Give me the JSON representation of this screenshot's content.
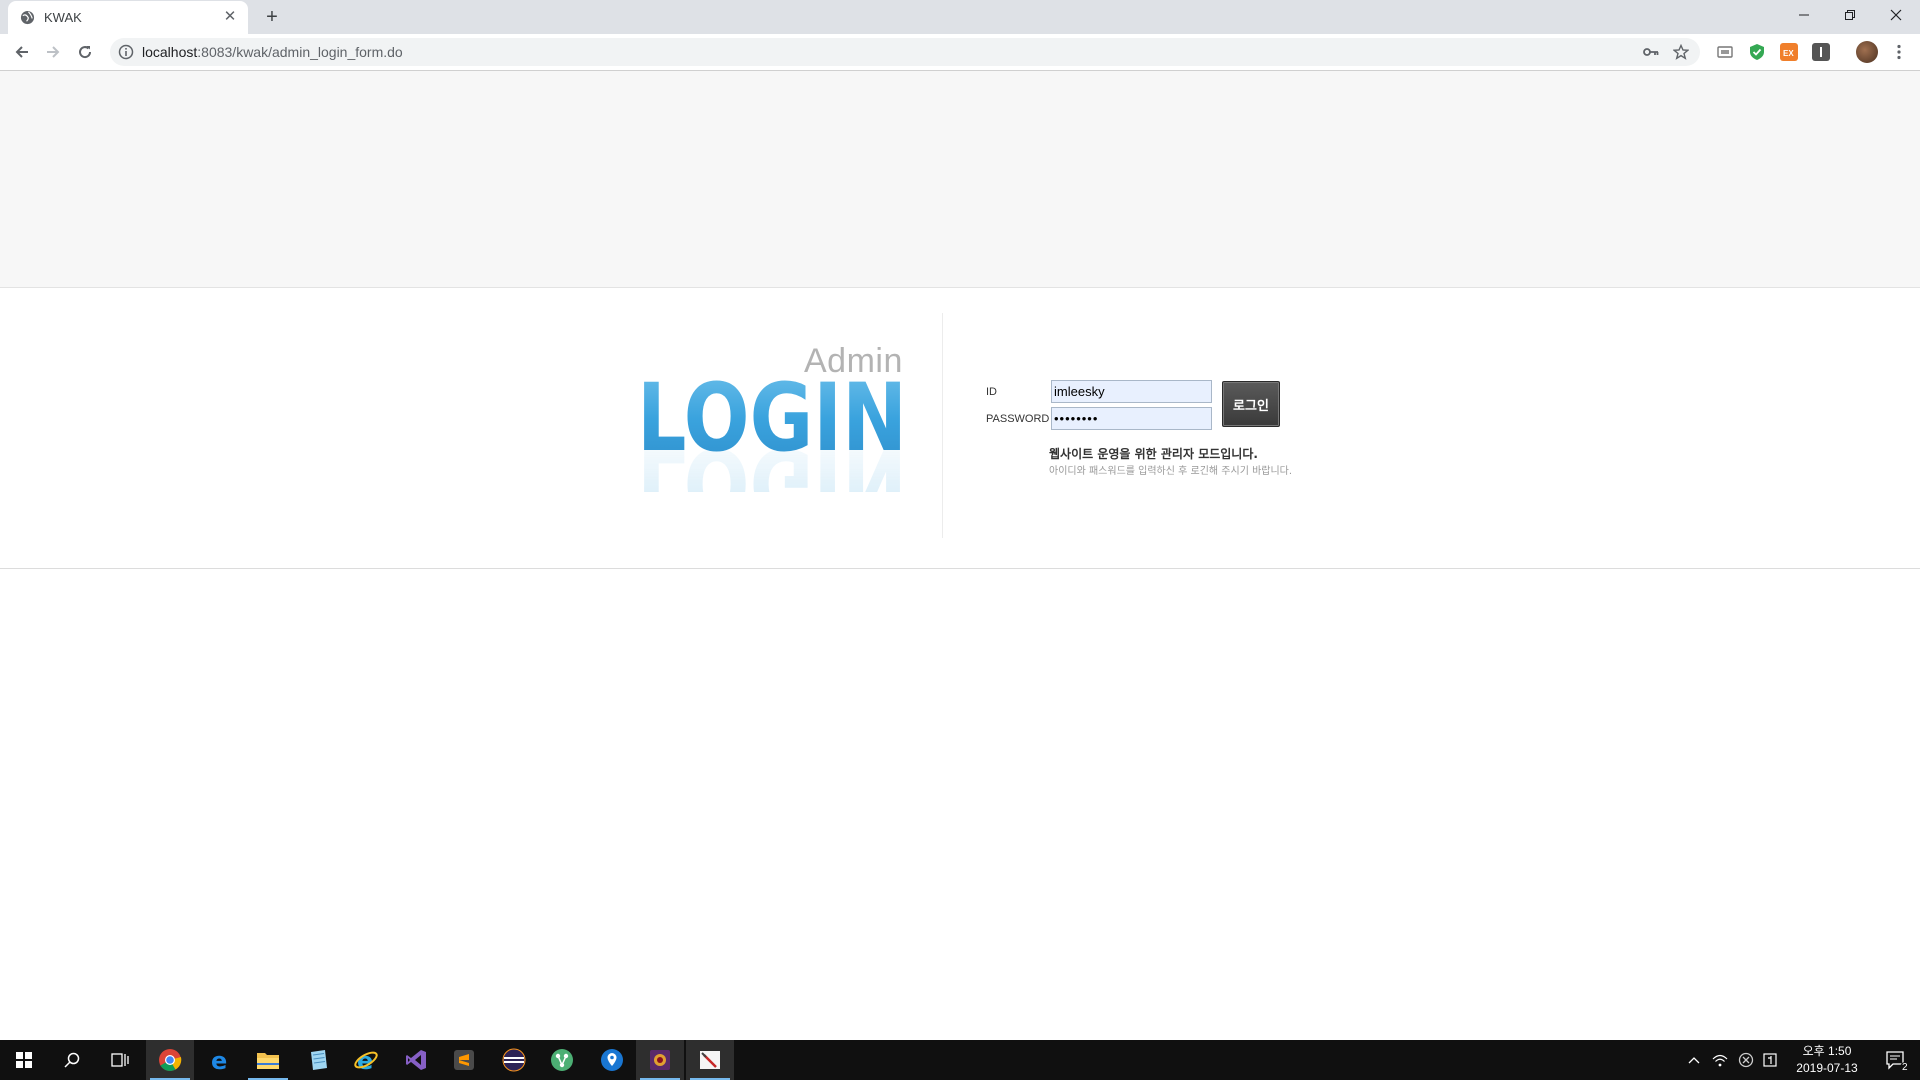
{
  "browser": {
    "tab_title": "KWAK",
    "new_tab_label": "+",
    "url_host": "localhost",
    "url_rest": ":8083/kwak/admin_login_form.do"
  },
  "login": {
    "admin_text": "Admin",
    "logo_text": "LOGIN",
    "id_label": "ID",
    "password_label": "PASSWORD",
    "id_value": "imleesky",
    "password_value": "••••••••",
    "button_label": "로그인",
    "notice_main": "웹사이트 운영을 위한 관리자 모드입니다.",
    "notice_sub": "아이디와 패스워드를 입력하신 후 로긴해 주시기 바랍니다."
  },
  "colors": {
    "logo_blue": "#3aa3de",
    "logo_light": "#8fd0f2",
    "field_bg": "#e8f0fe",
    "button_bg": "#444444"
  },
  "taskbar": {
    "clock_period_time": "오후 1:50",
    "clock_date": "2019-07-13",
    "notification_count": "2",
    "apps": [
      "chrome-icon",
      "edge-icon",
      "file-explorer-icon",
      "notepad-icon",
      "ie-icon",
      "visual-studio-icon",
      "sublime-icon",
      "eclipse-icon",
      "git-icon",
      "maps-icon",
      "app-icon",
      "paint-icon"
    ]
  }
}
